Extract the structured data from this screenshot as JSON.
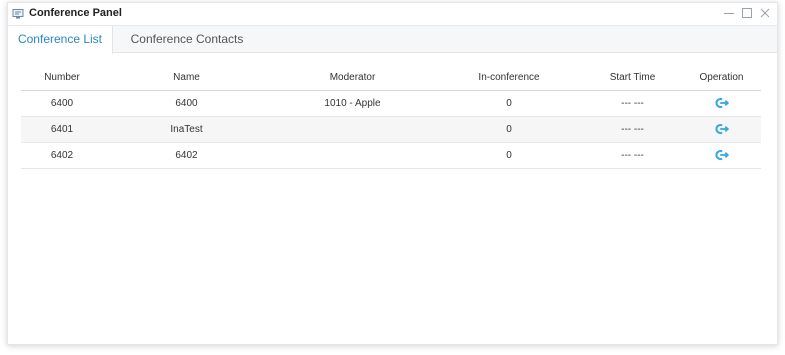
{
  "window": {
    "title": "Conference Panel",
    "controls": [
      "minimize",
      "maximize",
      "close"
    ]
  },
  "tabs": [
    {
      "label": "Conference List",
      "active": true
    },
    {
      "label": "Conference Contacts",
      "active": false
    }
  ],
  "table": {
    "headers": {
      "number": "Number",
      "name": "Name",
      "moderator": "Moderator",
      "in_conference": "In-conference",
      "start_time": "Start Time",
      "operation": "Operation"
    },
    "rows": [
      {
        "number": "6400",
        "name": "6400",
        "moderator": "1010 - Apple",
        "in_conference": "0",
        "start_time": "--- ---",
        "operation_icon": "join-conference-icon"
      },
      {
        "number": "6401",
        "name": "InaTest",
        "moderator": "",
        "in_conference": "0",
        "start_time": "--- ---",
        "operation_icon": "join-conference-icon"
      },
      {
        "number": "6402",
        "name": "6402",
        "moderator": "",
        "in_conference": "0",
        "start_time": "--- ---",
        "operation_icon": "join-conference-icon"
      }
    ]
  },
  "colors": {
    "accent": "#2b86c8",
    "icon_blue": "#35a8e0"
  }
}
